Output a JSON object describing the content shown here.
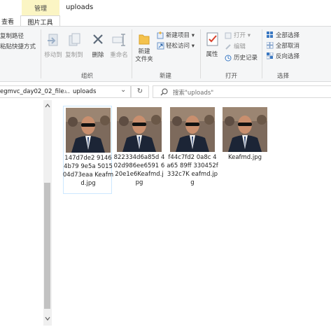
{
  "titlebar": {
    "context_tab": "管理",
    "window_title": "uploads"
  },
  "tabs": {
    "view": "查看",
    "picture_tools": "图片工具"
  },
  "ribbon": {
    "clipboard": {
      "copy_path": "复制路径",
      "paste_shortcut": "粘贴快捷方式"
    },
    "organize": {
      "move_to": "移动到",
      "copy_to": "复制到",
      "delete": "删除",
      "rename": "重命名",
      "group": "组织"
    },
    "new": {
      "new_folder_l1": "新建",
      "new_folder_l2": "文件夹",
      "new_item": "新建项目 ▾",
      "easy_access": "轻松访问 ▾",
      "group": "新建"
    },
    "open": {
      "properties": "属性",
      "open": "打开 ▾",
      "edit": "编辑",
      "history": "历史记录",
      "group": "打开"
    },
    "select": {
      "select_all": "全部选择",
      "select_none": "全部取消",
      "invert": "反向选择",
      "group": "选择"
    }
  },
  "address": {
    "prev_segment": "egmvc_day02_02_file...",
    "arrow": "›",
    "current": "uploads",
    "dropdown": "⌄",
    "refresh": "↻",
    "search_placeholder": "搜索\"uploads\""
  },
  "files": [
    {
      "name": "147d7de2 9146 4b79 9e5a 501504d73eaa Keafmd.jpg",
      "selected": true
    },
    {
      "name": "822334d6a85d 402d986ee6591 620e1e6Keafmd.jpg",
      "selected": false
    },
    {
      "name": "f44c7fd2 0a8c 4a65 89ff 330452f332c7K eafmd.jpg",
      "selected": false
    },
    {
      "name": "Keafmd.jpg",
      "selected": false
    }
  ],
  "colors": {
    "accent": "#0078d7",
    "ribbon_bg": "#f5f6f7",
    "context_tab": "#fbf5c4",
    "selection": "#cde8ff"
  },
  "icons": [
    "move-to-icon",
    "copy-to-icon",
    "delete-icon",
    "rename-icon",
    "new-folder-icon",
    "new-item-icon",
    "easy-access-icon",
    "properties-icon",
    "open-icon",
    "edit-icon",
    "history-icon",
    "select-all-icon",
    "select-none-icon",
    "invert-selection-icon",
    "refresh-icon",
    "search-icon",
    "scroll-up-icon",
    "scroll-down-icon"
  ]
}
